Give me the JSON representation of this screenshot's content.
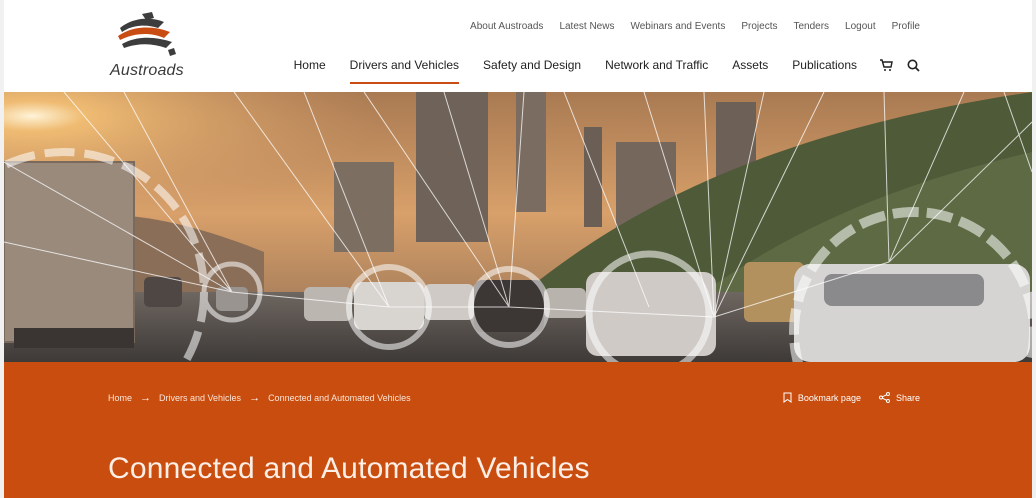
{
  "brand": {
    "logo_text": "Austroads"
  },
  "utility_nav": [
    "About Austroads",
    "Latest News",
    "Webinars and Events",
    "Projects",
    "Tenders",
    "Logout",
    "Profile"
  ],
  "main_nav": [
    {
      "label": "Home",
      "active": false
    },
    {
      "label": "Drivers and Vehicles",
      "active": true
    },
    {
      "label": "Safety and Design",
      "active": false
    },
    {
      "label": "Network and Traffic",
      "active": false
    },
    {
      "label": "Assets",
      "active": false
    },
    {
      "label": "Publications",
      "active": false
    }
  ],
  "nav_icons": [
    "cart-icon",
    "search-icon"
  ],
  "breadcrumb": [
    "Home",
    "Drivers and Vehicles",
    "Connected and Automated Vehicles"
  ],
  "actions": {
    "bookmark": "Bookmark page",
    "share": "Share"
  },
  "page_title": "Connected and Automated Vehicles",
  "colors": {
    "accent": "#c94d0e",
    "nav_active_underline": "#c94d12"
  }
}
